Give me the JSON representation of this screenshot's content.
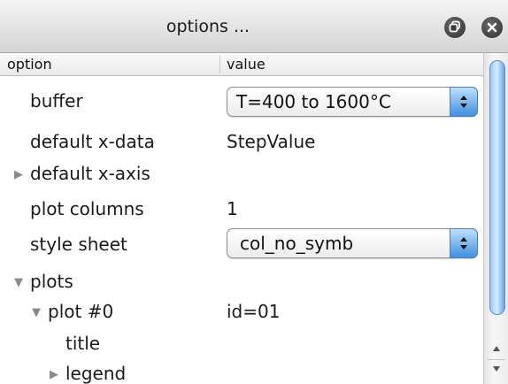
{
  "window": {
    "title": "options ...",
    "icons": [
      "restore-icon",
      "close-icon"
    ]
  },
  "header": {
    "option_label": "option",
    "value_label": "value"
  },
  "rows": {
    "buffer": {
      "label": "buffer",
      "value": "T=400 to 1600°C"
    },
    "default_x_data": {
      "label": "default x-data",
      "value": "StepValue"
    },
    "default_x_axis": {
      "label": "default x-axis",
      "expanded": false
    },
    "plot_columns": {
      "label": "plot columns",
      "value": "1"
    },
    "style_sheet": {
      "label": "style sheet",
      "value": "col_no_symb"
    },
    "plots": {
      "label": "plots",
      "expanded": true
    },
    "plot_0": {
      "label": "plot #0",
      "value": "id=01",
      "expanded": true
    },
    "title": {
      "label": "title"
    },
    "legend": {
      "label": "legend",
      "expanded": false
    }
  },
  "colors": {
    "accent": "#3f8fe0",
    "disclosure": "#8a8a8a"
  }
}
